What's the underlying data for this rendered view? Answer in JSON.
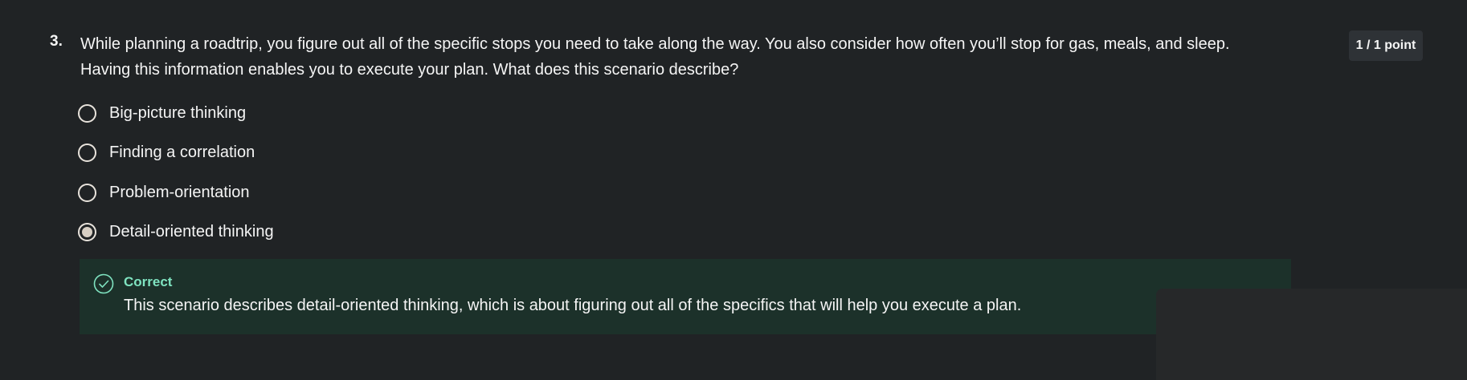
{
  "question": {
    "number": "3.",
    "text_line1": "While planning a roadtrip, you figure out all of the specific stops you need to take along the way. You also consider how often you’ll stop for gas, meals, and sleep.",
    "text_line2": "Having this information enables you to execute your plan. What does this scenario describe?",
    "points": "1 / 1 point"
  },
  "options": [
    {
      "label": "Big-picture thinking",
      "selected": false
    },
    {
      "label": "Finding a correlation",
      "selected": false
    },
    {
      "label": "Problem-orientation",
      "selected": false
    },
    {
      "label": "Detail-oriented thinking",
      "selected": true
    }
  ],
  "feedback": {
    "icon": "check-circle-icon",
    "title": "Correct",
    "text": "This scenario describes detail-oriented thinking, which is about figuring out all of the specifics that will help you execute a plan."
  },
  "colors": {
    "background": "#202325",
    "feedback_background": "#1c312a",
    "correct_accent": "#7fe3c0",
    "radio_border": "#e8e3dc"
  }
}
